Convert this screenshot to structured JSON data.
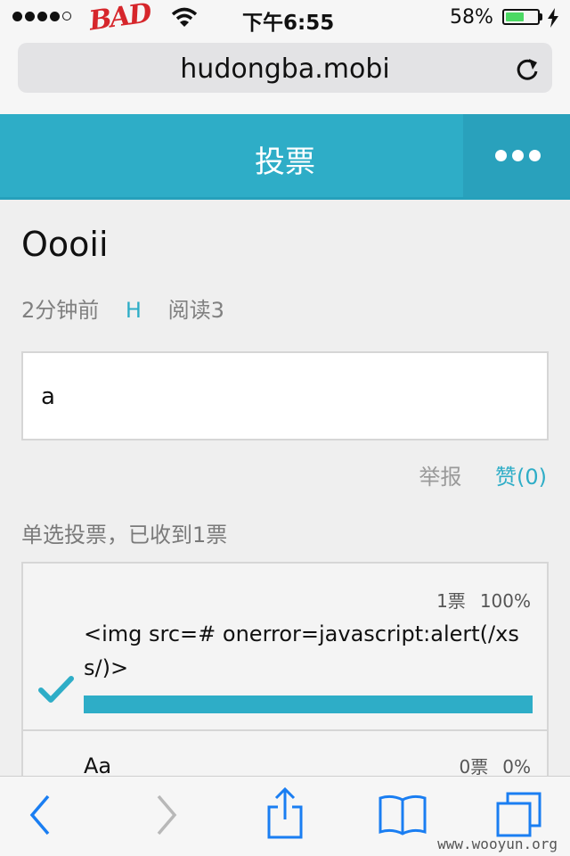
{
  "status_bar": {
    "carrier": "BAD",
    "time": "下午6:55",
    "battery_percent": "58%",
    "battery_level": 0.58,
    "signal_bars": 4
  },
  "browser": {
    "url": "hudongba.mobi"
  },
  "header": {
    "title": "投票"
  },
  "post": {
    "title": "Oooii",
    "time_ago": "2分钟前",
    "author": "H",
    "reads": "阅读3",
    "body": "a",
    "report_label": "举报",
    "like_label": "赞(0)",
    "vote_status": "单选投票，已收到1票"
  },
  "options": [
    {
      "text": "<img src=# onerror=javascript:alert(/xss/)>",
      "votes": "1票",
      "percent_label": "100%",
      "fraction": 1.0,
      "selected": true
    },
    {
      "text": "Aa",
      "votes": "0票",
      "percent_label": "0%",
      "fraction": 0.0,
      "selected": false
    }
  ],
  "watermark": "www.wooyun.org",
  "colors": {
    "accent": "#2eadc7",
    "battery": "#4cd964",
    "toolbar_icon": "#1a7ef2"
  }
}
